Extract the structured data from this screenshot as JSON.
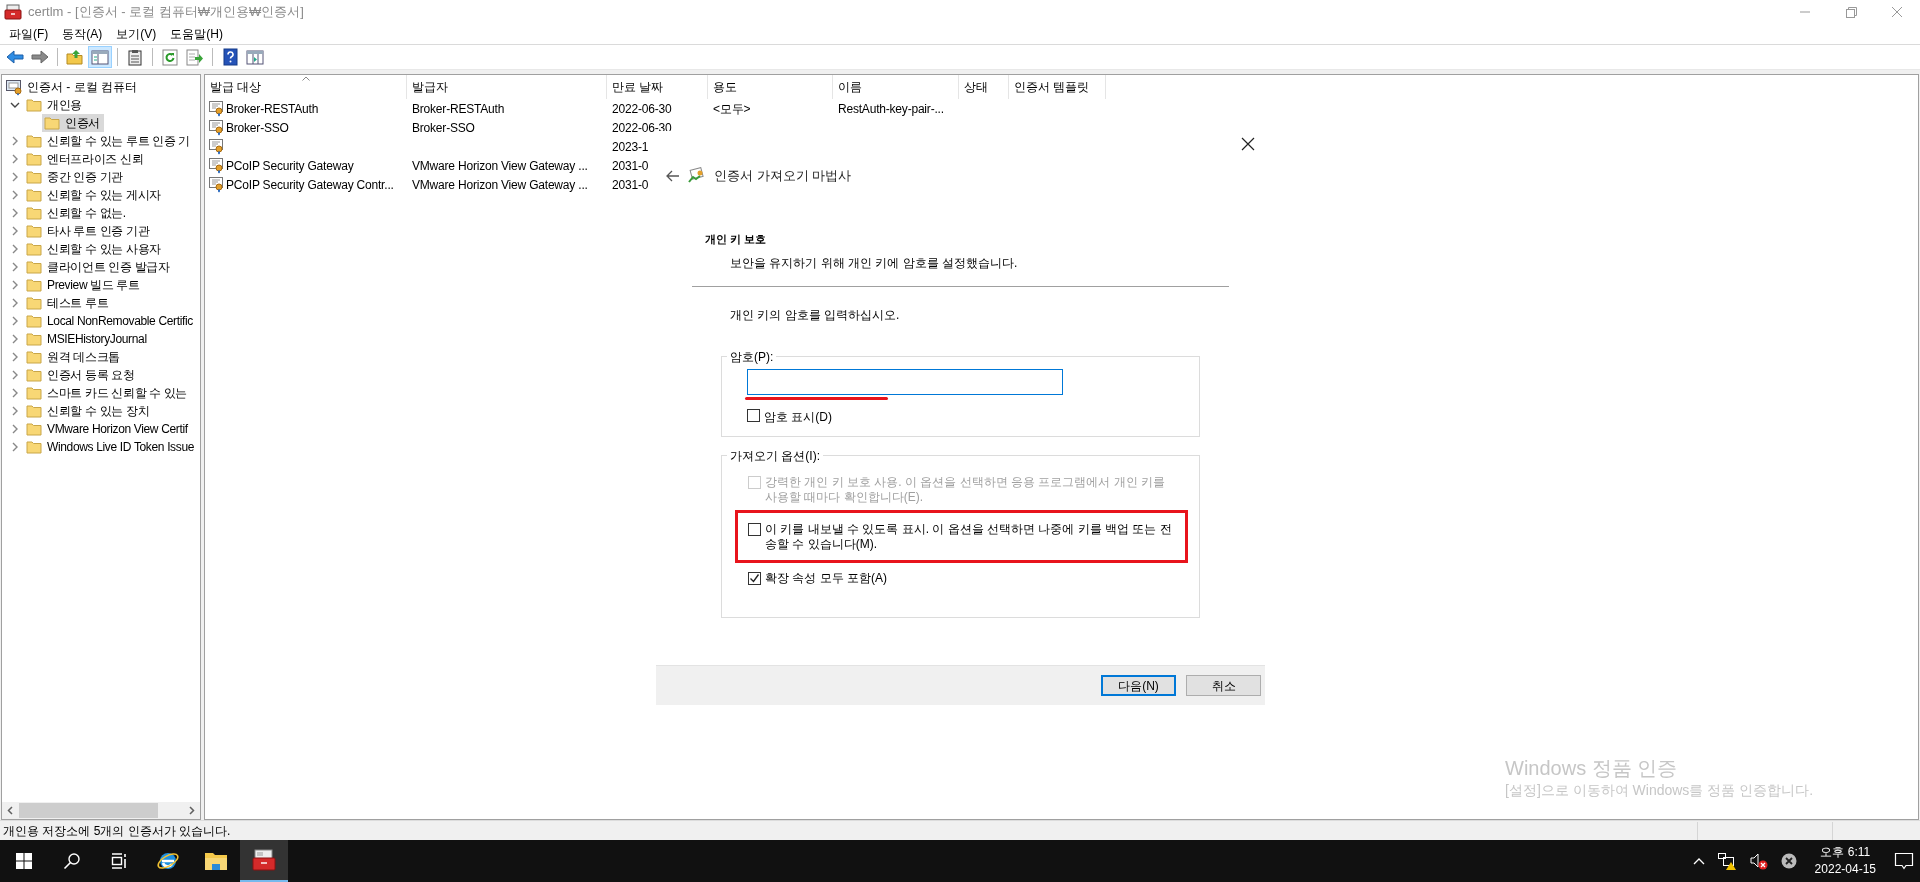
{
  "window": {
    "title": "certlm - [인증서 - 로컬 컴퓨터₩개인용₩인증서]"
  },
  "menu": [
    "파일(F)",
    "동작(A)",
    "보기(V)",
    "도움말(H)"
  ],
  "toolbar": [
    {
      "kind": "back",
      "pressed": false
    },
    {
      "kind": "forward",
      "pressed": false
    },
    {
      "kind": "separator"
    },
    {
      "kind": "up",
      "pressed": false
    },
    {
      "kind": "tree",
      "pressed": true
    },
    {
      "kind": "separator"
    },
    {
      "kind": "properties",
      "pressed": false
    },
    {
      "kind": "separator"
    },
    {
      "kind": "refresh",
      "pressed": false
    },
    {
      "kind": "export",
      "pressed": false
    },
    {
      "kind": "separator"
    },
    {
      "kind": "help",
      "pressed": false
    },
    {
      "kind": "columns",
      "pressed": false
    }
  ],
  "tree": {
    "label": "인증서 - 로컬 컴퓨터",
    "children": [
      {
        "label": "개인용",
        "expanded": true,
        "selected": false,
        "children": [
          {
            "label": "인증서",
            "selected": true
          }
        ]
      },
      {
        "label": "신뢰할 수 있는 루트 인증 기",
        "expanded": false,
        "selected": false
      },
      {
        "label": "엔터프라이즈 신뢰",
        "expanded": false,
        "selected": false
      },
      {
        "label": "중간 인증 기관",
        "expanded": false,
        "selected": false
      },
      {
        "label": "신뢰할 수 있는 게시자",
        "expanded": false,
        "selected": false
      },
      {
        "label": "신뢰할 수 없는.",
        "expanded": false,
        "selected": false
      },
      {
        "label": "타사 루트 인증 기관",
        "expanded": false,
        "selected": false
      },
      {
        "label": "신뢰할 수 있는 사용자",
        "expanded": false,
        "selected": false
      },
      {
        "label": "클라이언트 인증 발급자",
        "expanded": false,
        "selected": false
      },
      {
        "label": "Preview 빌드 루트",
        "expanded": false,
        "selected": false
      },
      {
        "label": "테스트 루트",
        "expanded": false,
        "selected": false
      },
      {
        "label": "Local NonRemovable Certific",
        "expanded": false,
        "selected": false
      },
      {
        "label": "MSIEHistoryJournal",
        "expanded": false,
        "selected": false
      },
      {
        "label": "원격 데스크톱",
        "expanded": false,
        "selected": false
      },
      {
        "label": "인증서 등록 요청",
        "expanded": false,
        "selected": false
      },
      {
        "label": "스마트 카드 신뢰할 수 있는",
        "expanded": false,
        "selected": false
      },
      {
        "label": "신뢰할 수 있는 장치",
        "expanded": false,
        "selected": false
      },
      {
        "label": "VMware Horizon View Certif",
        "expanded": false,
        "selected": false
      },
      {
        "label": "Windows Live ID Token Issue",
        "expanded": false,
        "selected": false
      }
    ]
  },
  "table": {
    "columns": [
      {
        "label": "발급 대상",
        "sorted": true
      },
      {
        "label": "발급자",
        "sorted": false
      },
      {
        "label": "만료 날짜",
        "sorted": false
      },
      {
        "label": "용도",
        "sorted": false
      },
      {
        "label": "이름",
        "sorted": false
      },
      {
        "label": "상태",
        "sorted": false
      },
      {
        "label": "인증서 템플릿",
        "sorted": false
      }
    ],
    "rows": [
      {
        "issued_to": "Broker-RESTAuth",
        "issued_by": "Broker-RESTAuth",
        "expires": "2022-06-30",
        "purpose": "<모두>",
        "name": "RestAuth-key-pair-..."
      },
      {
        "issued_to": "Broker-SSO",
        "issued_by": "Broker-SSO",
        "expires": "2022-06-30"
      },
      {
        "expires": "2023-1"
      },
      {
        "issued_to": "PCoIP Security Gateway",
        "issued_by": "VMware Horizon View Gateway ...",
        "expires": "2031-0"
      },
      {
        "issued_to": "PCoIP Security Gateway Contr...",
        "issued_by": "VMware Horizon View Gateway ...",
        "expires": "2031-0"
      }
    ]
  },
  "dialog": {
    "title": "인증서 가져오기 마법사",
    "heading": "개인 키 보호",
    "subheading": "보안을 유지하기 위해 개인 키에 암호를 설정했습니다.",
    "prompt": "개인 키의 암호를 입력하십시오.",
    "password_group": {
      "label": "암호(P):",
      "field": {
        "focused": true
      },
      "show_password": {
        "label": "암호 표시(D)",
        "checked": false
      }
    },
    "options_group": {
      "label": "가져오기 옵션(I):",
      "options": [
        {
          "label": "강력한 개인 키 보호 사용. 이 옵션을 선택하면 응용 프로그램에서 개인 키를 사용할 때마다 확인합니다(E).",
          "checked": false,
          "disabled": true
        },
        {
          "label": "이 키를 내보낼 수 있도록 표시. 이 옵션을 선택하면 나중에 키를 백업 또는 전송할 수 있습니다(M).",
          "checked": false,
          "disabled": false
        },
        {
          "label": "확장 속성 모두 포함(A)",
          "checked": true,
          "disabled": false
        }
      ]
    },
    "buttons": [
      {
        "label": "다음(N)",
        "default": true
      },
      {
        "label": "취소",
        "default": false
      }
    ]
  },
  "status_bar": {
    "text": "개인용 저장소에 5개의 인증서가 있습니다."
  },
  "activation_notice": {
    "title": "Windows 정품 인증",
    "text": "[설정]으로 이동하여 Windows를 정품 인증합니다."
  },
  "taskbar": {
    "apps": [
      {
        "kind": "start",
        "active": false
      },
      {
        "kind": "search",
        "active": false
      },
      {
        "kind": "task_view",
        "active": false
      },
      {
        "kind": "browser",
        "active": false
      },
      {
        "kind": "explorer",
        "active": false
      },
      {
        "kind": "certlm",
        "active": true
      }
    ],
    "clock": {
      "time": "오후 6:11",
      "date": "2022-04-15"
    }
  }
}
